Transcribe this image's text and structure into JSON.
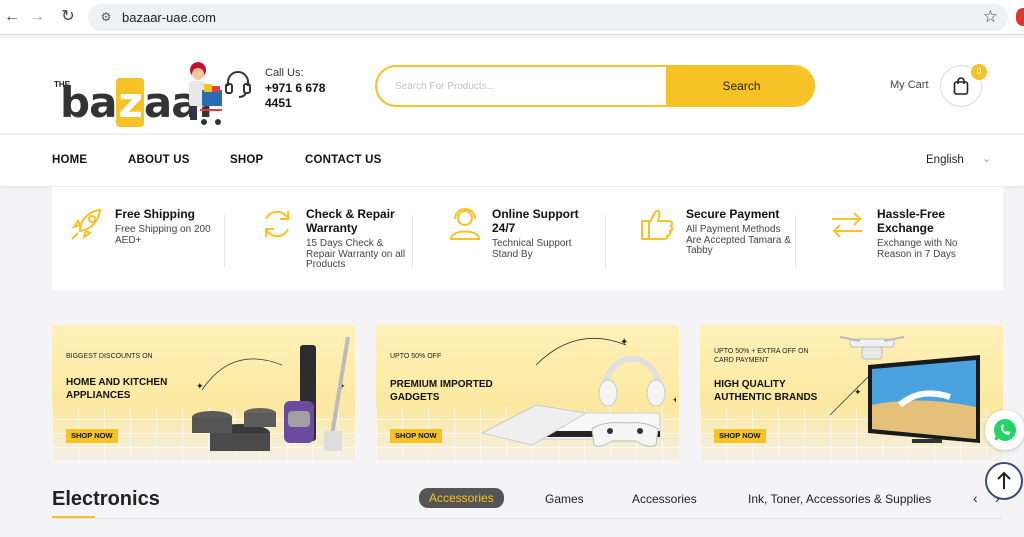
{
  "browser": {
    "url": "bazaar-uae.com"
  },
  "header": {
    "logo_the": "THE",
    "logo_word_pre": "ba",
    "logo_word_z": "z",
    "logo_word_post": "aar",
    "call_label": "Call Us:",
    "call_number": "+971 6 678 4451",
    "search_placeholder": "Search For Products...",
    "search_button": "Search",
    "cart_label": "My Cart",
    "cart_count": "0"
  },
  "nav": {
    "items": [
      "HOME",
      "ABOUT US",
      "SHOP",
      "CONTACT US"
    ],
    "language": "English"
  },
  "features": [
    {
      "title": "Free Shipping",
      "desc": "Free Shipping on 200 AED+",
      "icon": "rocket-icon"
    },
    {
      "title": "Check & Repair Warranty",
      "desc": "15 Days Check & Repair Warranty on all Products",
      "icon": "refresh-icon"
    },
    {
      "title": "Online Support 24/7",
      "desc": "Technical Support Stand By",
      "icon": "support-agent-icon"
    },
    {
      "title": "Secure Payment",
      "desc": "All Payment Methods Are Accepted Tamara & Tabby",
      "icon": "thumbs-up-icon"
    },
    {
      "title": "Hassle-Free Exchange",
      "desc": "Exchange with No Reason in 7 Days",
      "icon": "exchange-arrows-icon"
    }
  ],
  "banners": [
    {
      "kicker": "BIGGEST DISCOUNTS ON",
      "headline": "HOME AND KITCHEN APPLIANCES",
      "cta": "SHOP NOW"
    },
    {
      "kicker": "UPTO 50% OFF",
      "headline": "PREMIUM IMPORTED GADGETS",
      "cta": "SHOP NOW"
    },
    {
      "kicker": "UPTO 50% + EXTRA OFF ON CARD PAYMENT",
      "headline": "HIGH QUALITY AUTHENTIC BRANDS",
      "cta": "SHOP NOW"
    }
  ],
  "electronics": {
    "title": "Electronics",
    "tabs": [
      "Accessories",
      "Games",
      "Accessories",
      "Ink, Toner, Accessories & Supplies"
    ],
    "active_tab": 0
  },
  "colors": {
    "accent": "#f6c225",
    "text": "#222222"
  }
}
